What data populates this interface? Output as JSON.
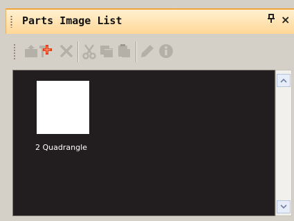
{
  "panel": {
    "title": "Parts Image List",
    "pin_glyph": "ㅁ",
    "close_glyph": "×"
  },
  "toolbar": {
    "buttons": [
      {
        "name": "import-image-button",
        "icon": "import-icon"
      },
      {
        "name": "add-part-button",
        "icon": "add-part-icon"
      },
      {
        "name": "delete-button",
        "icon": "delete-icon"
      },
      {
        "name": "cut-button",
        "icon": "cut-icon"
      },
      {
        "name": "copy-button",
        "icon": "copy-icon"
      },
      {
        "name": "paste-button",
        "icon": "paste-icon"
      },
      {
        "name": "edit-button",
        "icon": "pencil-icon"
      },
      {
        "name": "info-button",
        "icon": "info-icon"
      }
    ]
  },
  "items": [
    {
      "label": "2 Quadrangle"
    }
  ],
  "colors": {
    "title_gradient_top": "#fff1d2",
    "title_gradient_bottom": "#ffd796",
    "view_background": "#221e1f",
    "disabled_icon": "#b3b0a8"
  }
}
